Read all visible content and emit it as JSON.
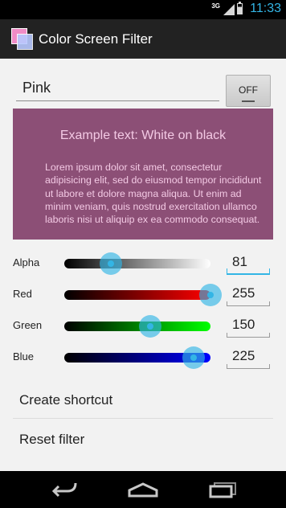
{
  "status_bar": {
    "network": "3G",
    "time": "11:33"
  },
  "app": {
    "title": "Color Screen Filter",
    "icon": "app-logo-icon"
  },
  "filter": {
    "name": "Pink",
    "toggle_label": "OFF"
  },
  "preview": {
    "title": "Example text: White on black",
    "body": "Lorem ipsum dolor sit amet, consectetur adipisicing elit, sed do eiusmod tempor incididunt ut labore et dolore magna aliqua. Ut enim ad minim veniam, quis nostrud exercitation ullamco laboris nisi ut aliquip ex ea commodo consequat.",
    "background": "#8c4f76",
    "text_color": "#f3c9e4"
  },
  "sliders": [
    {
      "label": "Alpha",
      "value": "81",
      "level": 0.318,
      "gradient": [
        "#000000",
        "#ffffff"
      ]
    },
    {
      "label": "Red",
      "value": "255",
      "level": 1.0,
      "gradient": [
        "#000000",
        "#ff0000"
      ]
    },
    {
      "label": "Green",
      "value": "150",
      "level": 0.588,
      "gradient": [
        "#000000",
        "#00ff00"
      ]
    },
    {
      "label": "Blue",
      "value": "225",
      "level": 0.882,
      "gradient": [
        "#000000",
        "#0000ff"
      ]
    }
  ],
  "menu": {
    "create_shortcut": "Create shortcut",
    "reset_filter": "Reset filter"
  },
  "nav": {
    "back": "back-icon",
    "home": "home-icon",
    "recents": "recents-icon"
  },
  "accent": "#33b5e5"
}
